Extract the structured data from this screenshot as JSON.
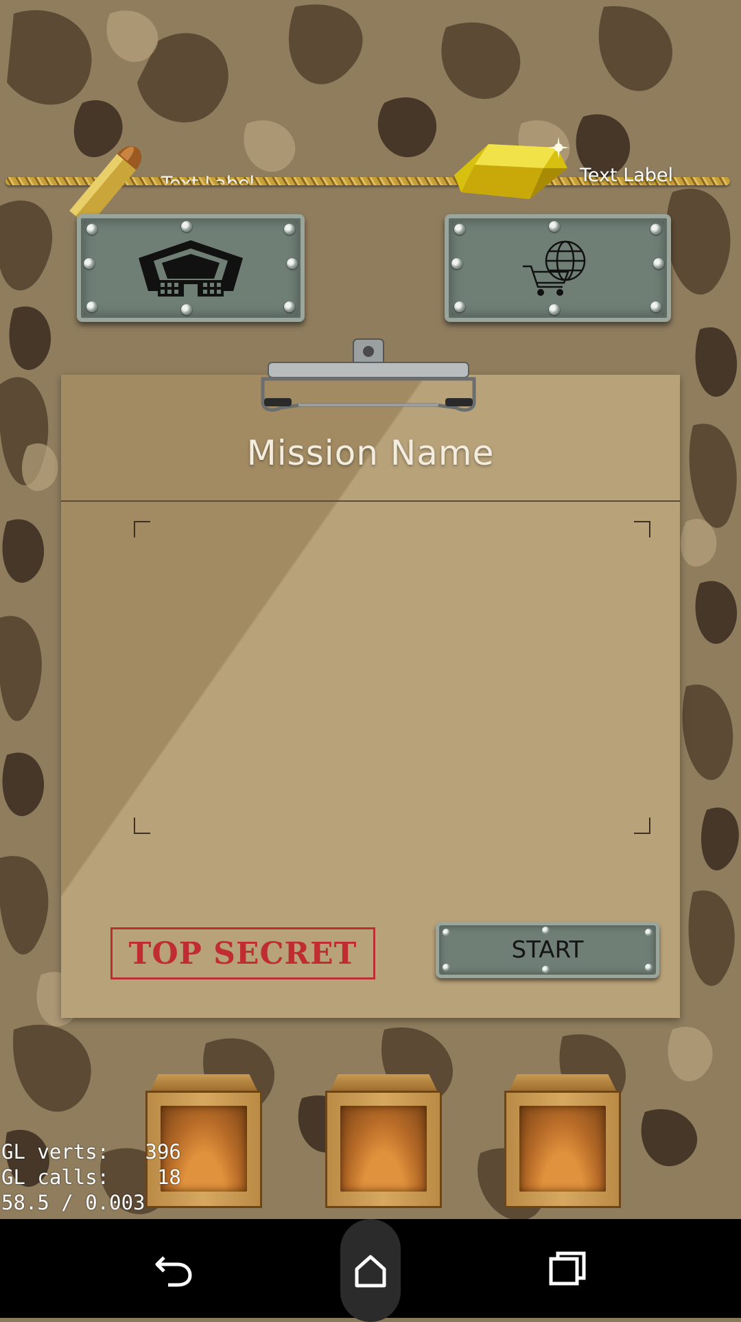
{
  "top_bar": {
    "ammo_label": "Text Label",
    "gold_label": "Text Label"
  },
  "menu_buttons": [
    {
      "name": "headquarters",
      "icon": "pentagon-building-icon"
    },
    {
      "name": "shop",
      "icon": "globe-shopping-cart-icon"
    }
  ],
  "mission": {
    "title": "Mission Name",
    "stamp": "TOP SECRET",
    "start_label": "START"
  },
  "crates": [
    {
      "icon": "wooden-crate-icon"
    },
    {
      "icon": "wooden-crate-icon"
    },
    {
      "icon": "wooden-crate-icon"
    }
  ],
  "debug": {
    "line1": "GL verts:   396",
    "line2": "GL calls:    18",
    "line3": "58.5 / 0.003"
  },
  "navbar": {
    "back_icon": "back-arrow-icon",
    "home_icon": "home-icon",
    "recents_icon": "recents-icon"
  },
  "colors": {
    "camo_base": "#8f7d5e",
    "camo_dark": "#4a3a28",
    "camo_light": "#b7a37d",
    "plate": "#6f7f76",
    "paper": "#b8a27a",
    "stamp_red": "#c0202a",
    "gold": "#e8d21a"
  }
}
